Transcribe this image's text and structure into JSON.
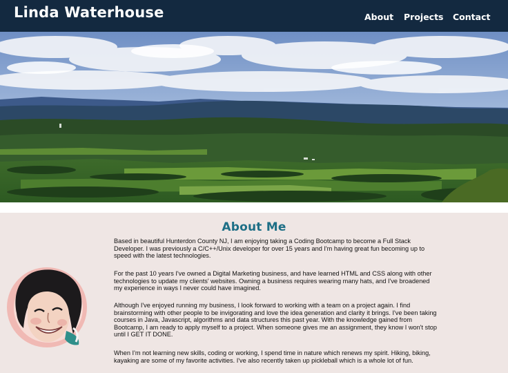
{
  "header": {
    "brand": "Linda Waterhouse",
    "nav": [
      {
        "label": "About"
      },
      {
        "label": "Projects"
      },
      {
        "label": "Contact"
      }
    ]
  },
  "about": {
    "title": "About Me",
    "paragraphs": [
      "Based in beautiful Hunterdon County NJ, I am enjoying taking a Coding Bootcamp to become a Full Stack Developer. I was previously a C/C++/Unix developer for over 15 years and I'm having great fun becoming up to speed with the latest technologies.",
      "For the past 10 years I've owned a Digital Marketing business, and have learned HTML and CSS along with other technologies to update my clients' websites. Owning a business requires wearing many hats, and I've broadened my experience in ways I never could have imagined.",
      "Although I've enjoyed running my business, I look forward to working with a team on a project again. I find brainstorming with other people to be invigorating and love the idea generation and clarity it brings. I've been taking courses in Java, Javascript, algorithms and data structures this past year. With the knowledge gained from Bootcamp, I am ready to apply myself to a project. When someone gives me an assignment, they know I won't stop until I GET IT DONE.",
      "When I'm not learning new skills, coding or working, I spend time in nature which renews my spirit. Hiking, biking, kayaking are some of my favorite activities. I've also recently taken up pickleball which is a whole lot of fun."
    ]
  },
  "colors": {
    "header_bg": "#132940",
    "about_bg": "#efe6e4",
    "title_color": "#1e6f86"
  }
}
